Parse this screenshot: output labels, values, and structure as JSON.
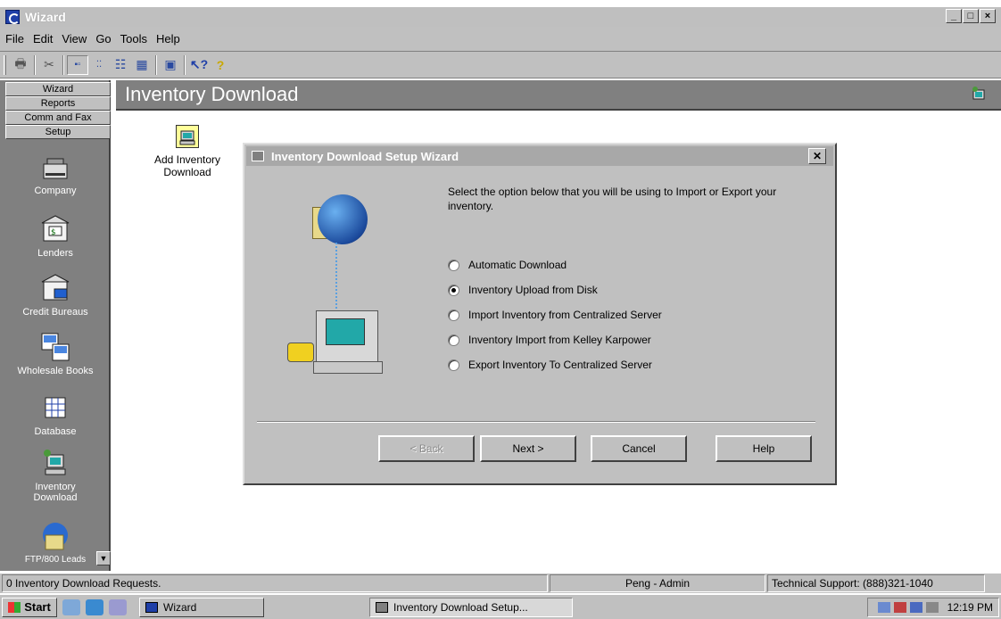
{
  "window": {
    "title": "Wizard",
    "controls": [
      "_",
      "□",
      "×"
    ]
  },
  "menu": [
    "File",
    "Edit",
    "View",
    "Go",
    "Tools",
    "Help"
  ],
  "toolbar": {
    "buttons": [
      "printer-icon",
      "scissors-icon",
      "large-icons-icon",
      "small-icons-icon",
      "list-icon",
      "details-icon",
      "monitor-icon",
      "help-pointer-icon",
      "question-icon"
    ]
  },
  "leftnav": {
    "sections": [
      "Wizard",
      "Reports",
      "Comm and Fax",
      "Setup"
    ],
    "items": [
      {
        "label": "Company",
        "icon": "company-icon"
      },
      {
        "label": "Lenders",
        "icon": "lenders-icon"
      },
      {
        "label": "Credit Bureaus",
        "icon": "credit-bureaus-icon"
      },
      {
        "label": "Wholesale Books",
        "icon": "wholesale-books-icon"
      },
      {
        "label": "Database",
        "icon": "database-icon"
      },
      {
        "label": "Inventory Download",
        "icon": "inventory-download-icon"
      },
      {
        "label": "FTP/800 Leads",
        "icon": "ftp-icon"
      }
    ]
  },
  "content": {
    "title": "Inventory Download",
    "items": [
      {
        "label": "Add Inventory Download",
        "icon": "add-inventory-download-icon"
      }
    ]
  },
  "dialog": {
    "title": "Inventory Download Setup Wizard",
    "prompt": "Select the option below that you will be using to Import or Export your inventory.",
    "options": [
      {
        "label": "Automatic Download",
        "selected": false
      },
      {
        "label": "Inventory Upload from Disk",
        "selected": true
      },
      {
        "label": "Import Inventory  from Centralized Server",
        "selected": false
      },
      {
        "label": "Inventory Import from Kelley Karpower",
        "selected": false
      },
      {
        "label": "Export Inventory To Centralized Server",
        "selected": false
      }
    ],
    "buttons": {
      "back": "< Back",
      "next": "Next >",
      "cancel": "Cancel",
      "help": "Help"
    }
  },
  "status": {
    "left": "0 Inventory Download Requests.",
    "user": "Peng - Admin",
    "support": "Technical Support: (888)321-1040"
  },
  "taskbar": {
    "start": "Start",
    "tasks": [
      "Wizard",
      "Inventory Download Setup..."
    ],
    "time": "12:19 PM"
  }
}
